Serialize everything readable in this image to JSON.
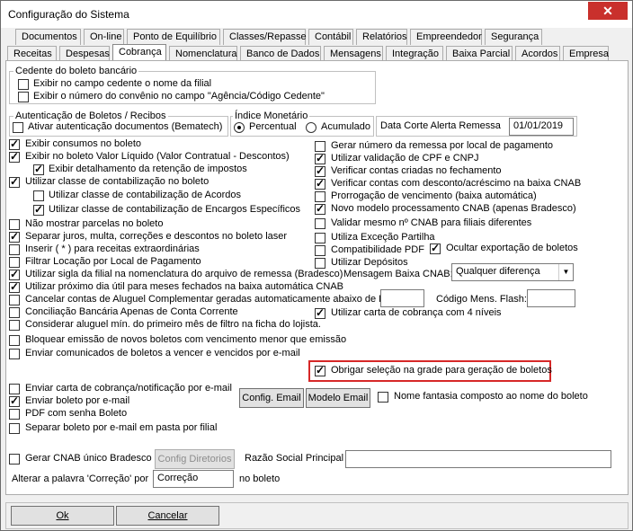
{
  "window": {
    "title": "Configuração do Sistema",
    "close_glyph": "✕"
  },
  "tabs_row1": [
    "Documentos",
    "On-line",
    "Ponto de Equilíbrio",
    "Classes/Repasse",
    "Contábil",
    "Relatórios",
    "Empreendedor",
    "Segurança"
  ],
  "tabs_row2": [
    "Receitas",
    "Despesas",
    "Cobrança",
    "Nomenclatura",
    "Banco de Dados",
    "Mensagens",
    "Integração",
    "Baixa Parcial",
    "Acordos",
    "Empresa"
  ],
  "cedente": {
    "title": "Cedente do boleto bancário",
    "opt1": "Exibir no campo cedente o nome da filial",
    "opt2": "Exibir o número do convênio no campo \"Agência/Código Cedente\""
  },
  "autentic": {
    "title": "Autenticação de Boletos / Recibos",
    "opt": "Ativar autenticação documentos (Bematech)"
  },
  "indice": {
    "title": "Índice Monetário",
    "opt1": "Percentual",
    "opt2": "Acumulado",
    "selected": "Percentual"
  },
  "alerta": {
    "label": "Data Corte Alerta Remessa",
    "value": "01/01/2019"
  },
  "left": [
    {
      "label": "Exibir consumos no boleto",
      "checked": true
    },
    {
      "label": "Exibir no boleto Valor Líquido (Valor Contratual - Descontos)",
      "checked": true
    },
    {
      "label": "Exibir detalhamento da retenção de impostos",
      "checked": true
    },
    {
      "label": "Utilizar classe de contabilização no boleto",
      "checked": true
    },
    {
      "label": "Utilizar classe de contabilização de Acordos",
      "checked": false
    },
    {
      "label": "Utilizar classe de contabilização de Encargos Específicos",
      "checked": true
    },
    {
      "label": "Não mostrar parcelas no boleto",
      "checked": false
    },
    {
      "label": "Separar juros, multa, correções e descontos no boleto laser",
      "checked": true
    },
    {
      "label": "Inserir ( * ) para receitas extraordinárias",
      "checked": false
    },
    {
      "label": "Filtrar Locação por Local de Pagamento",
      "checked": false
    },
    {
      "label": "Utilizar sigla da filial na nomenclatura do arquivo de remessa (Bradesco)",
      "checked": true
    },
    {
      "label": "Utilizar próximo dia útil para meses fechados na baixa automática CNAB",
      "checked": true
    },
    {
      "label": "Cancelar contas de Aluguel Complementar geradas automaticamente abaixo de R$",
      "checked": false
    },
    {
      "label": "Conciliação Bancária Apenas de Conta Corrente",
      "checked": false
    },
    {
      "label": "Considerar aluguel mín. do primeiro mês de filtro na ficha do lojista.",
      "checked": false
    },
    {
      "label": "Bloquear emissão de novos boletos com vencimento menor que emissão",
      "checked": false
    },
    {
      "label": "Enviar comunicados de boletos a vencer e vencidos por e-mail",
      "checked": false
    }
  ],
  "right": [
    {
      "label": "Gerar número da remessa por local de pagamento",
      "checked": false
    },
    {
      "label": "Utilizar validação de CPF e CNPJ",
      "checked": true
    },
    {
      "label": "Verificar contas criadas no fechamento",
      "checked": true
    },
    {
      "label": "Verificar contas com desconto/acréscimo na baixa CNAB",
      "checked": true
    },
    {
      "label": "Prorrogação de vencimento (baixa automática)",
      "checked": false
    },
    {
      "label": "Novo modelo processamento CNAB (apenas Bradesco)",
      "checked": true
    },
    {
      "label": "Validar mesmo nº CNAB para filiais diferentes",
      "checked": false
    },
    {
      "label": "Utiliza Exceção Partilha",
      "checked": false
    },
    {
      "label": "Compatibilidade PDF",
      "checked": false
    },
    {
      "label": "Utilizar Depósitos",
      "checked": false
    }
  ],
  "ocultar": {
    "label": "Ocultar exportação de boletos",
    "checked": true
  },
  "mensagem_baixa": {
    "label": "Mensagem Baixa CNAB:",
    "value": "Qualquer diferença"
  },
  "codigo_mens": {
    "label": "Código Mens. Flash:",
    "value": ""
  },
  "carta4": {
    "label": "Utilizar carta de cobrança com 4 níveis",
    "checked": true
  },
  "obrigar": {
    "label": "Obrigar seleção na grade para geração de boletos",
    "checked": true
  },
  "email_opts": [
    {
      "label": "Enviar carta de cobrança/notificação por e-mail",
      "checked": false
    },
    {
      "label": "Enviar boleto por e-mail",
      "checked": true
    },
    {
      "label": "PDF com senha Boleto",
      "checked": false
    },
    {
      "label": "Separar boleto por e-mail em pasta por filial",
      "checked": false
    }
  ],
  "buttons": {
    "config_email": "Config. Email",
    "modelo_email": "Modelo Email",
    "config_dir": "Config Diretorios",
    "ok": "Ok",
    "cancelar": "Cancelar"
  },
  "nome_fantasia": {
    "label": "Nome fantasia composto ao nome do boleto",
    "checked": false
  },
  "cnab_unico": {
    "label": "Gerar CNAB único Bradesco",
    "checked": false
  },
  "razao": {
    "label": "Razão Social Principal",
    "value": ""
  },
  "correcao": {
    "label_pre": "Alterar a palavra 'Correção' por",
    "value": "Correção",
    "label_post": "no boleto"
  }
}
